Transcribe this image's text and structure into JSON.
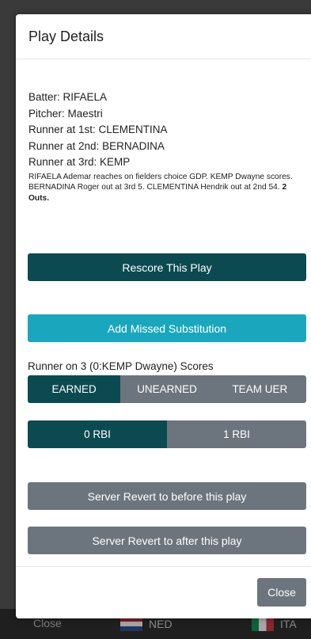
{
  "modal": {
    "title": "Play Details",
    "batter": "Batter: RIFAELA",
    "pitcher": "Pitcher: Maestri",
    "runner1": "Runner at 1st: CLEMENTINA",
    "runner2": "Runner at 2nd: BERNADINA",
    "runner3": "Runner at 3rd: KEMP",
    "narrative": "RIFAELA Ademar reaches on fielders choice GDP. KEMP Dwayne scores. BERNADINA Roger out at 3rd 5. CLEMENTINA Hendrik out at 2nd 54.",
    "narrative_outs": "2 Outs.",
    "rescore_label": "Rescore This Play",
    "add_sub_label": "Add Missed Substitution",
    "runner_scores_label": "Runner on 3 (0:KEMP Dwayne) Scores",
    "earned_options": [
      "EARNED",
      "UNEARNED",
      "TEAM UER"
    ],
    "earned_selected": "EARNED",
    "rbi_options": [
      "0 RBI",
      "1 RBI"
    ],
    "rbi_selected": "0 RBI",
    "revert_before_label": "Server Revert to before this play",
    "revert_after_label": "Server Revert to after this play",
    "close_label": "Close"
  },
  "background": {
    "close_label": "Close",
    "team_home": "NED",
    "team_away": "ITA"
  },
  "colors": {
    "primary_dark": "#0c4a52",
    "info_cyan": "#1aa7bd",
    "secondary_gray": "#6c757d"
  }
}
